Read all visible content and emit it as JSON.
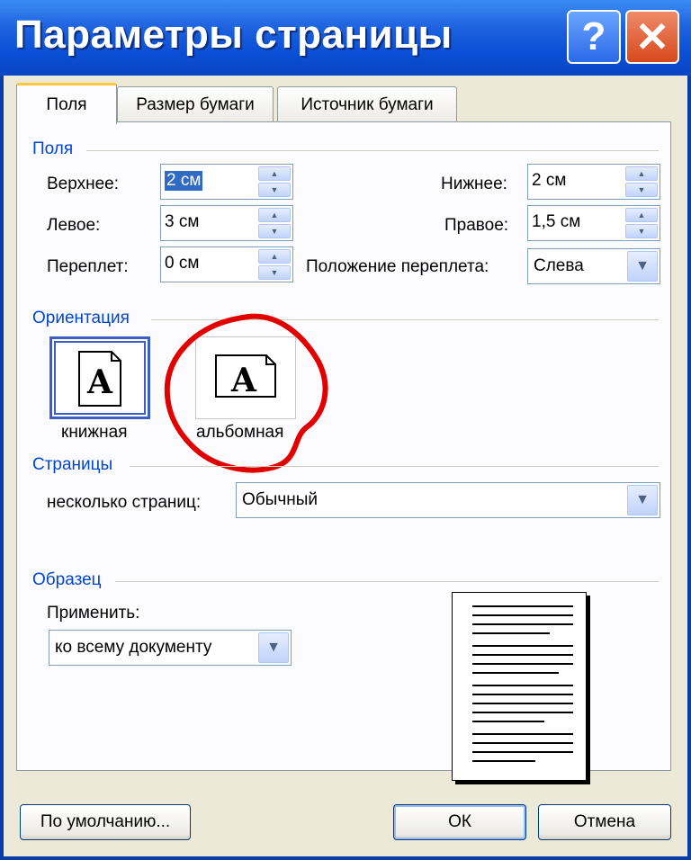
{
  "window": {
    "title": "Параметры страницы",
    "help_label": "?",
    "close_label": "✕"
  },
  "tabs": [
    {
      "label": "Поля"
    },
    {
      "label": "Размер бумаги"
    },
    {
      "label": "Источник бумаги"
    }
  ],
  "margins": {
    "group": "Поля",
    "top_label": "Верхнее:",
    "top_value": "2 см",
    "bottom_label": "Нижнее:",
    "bottom_value": "2 см",
    "left_label": "Левое:",
    "left_value": "3 см",
    "right_label": "Правое:",
    "right_value": "1,5 см",
    "gutter_label": "Переплет:",
    "gutter_value": "0 см",
    "gutter_pos_label": "Положение переплета:",
    "gutter_pos_value": "Слева"
  },
  "orientation": {
    "group": "Ориентация",
    "portrait_label": "книжная",
    "landscape_label": "альбомная",
    "icon_glyph": "A"
  },
  "pages": {
    "group": "Страницы",
    "multiple_label": "несколько страниц:",
    "multiple_value": "Обычный"
  },
  "sample": {
    "group": "Образец",
    "apply_label": "Применить:",
    "apply_value": "ко всему документу"
  },
  "buttons": {
    "default": "По умолчанию...",
    "ok": "ОК",
    "cancel": "Отмена"
  },
  "colors": {
    "accent": "#0046d5",
    "annotation": "#e00000"
  }
}
